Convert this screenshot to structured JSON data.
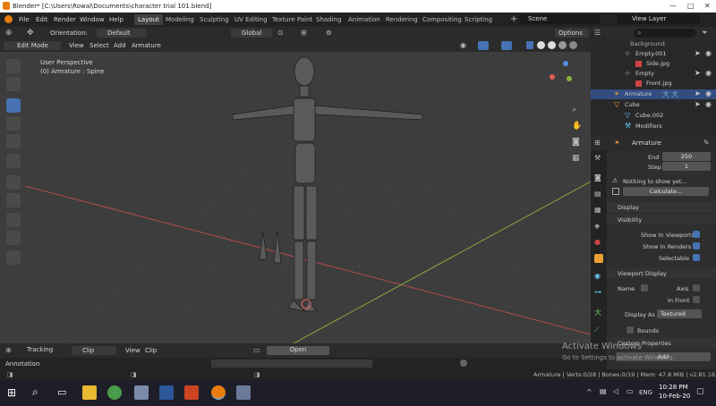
{
  "window": {
    "title": "Blender* [C:\\Users\\Rowal\\Documents\\character trial 101.blend]"
  },
  "menu": [
    "File",
    "Edit",
    "Render",
    "Window",
    "Help"
  ],
  "workspaces": [
    "Layout",
    "Modeling",
    "Sculpting",
    "UV Editing",
    "Texture Paint",
    "Shading",
    "Animation",
    "Rendering",
    "Compositing",
    "Scripting"
  ],
  "scene": {
    "name": "Scene",
    "view_layer": "View Layer"
  },
  "header": {
    "orientation_label": "Orientation:",
    "orientation_value": "Default",
    "transform": "Global",
    "options": "Options",
    "mode": "Edit Mode",
    "view": "View",
    "select": "Select",
    "add": "Add",
    "armature": "Armature"
  },
  "viewport": {
    "perspective": "User Perspective",
    "object": "(0) Armature : Spine",
    "axis_x": "X",
    "axis_y": "Y",
    "axis_z": "Z"
  },
  "timeline": {
    "tracking": "Tracking",
    "clip": "Clip",
    "view": "View",
    "clip2": "Clip",
    "open": "Open",
    "annotation": "Annotation"
  },
  "outliner": {
    "items": [
      {
        "label": "Background"
      },
      {
        "label": "Empty.001"
      },
      {
        "label": "Side.jpg"
      },
      {
        "label": "Empty"
      },
      {
        "label": "Front.jpg"
      },
      {
        "label": "Armature"
      },
      {
        "label": "Cube"
      },
      {
        "label": "Cube.002"
      },
      {
        "label": "Modifiers"
      }
    ]
  },
  "properties": {
    "object_name": "Armature",
    "end_label": "End",
    "end_value": "250",
    "step_label": "Step",
    "step_value": "1",
    "nothing": "Nothing to show yet...",
    "calculate": "Calculate...",
    "display": "Display",
    "visibility": "Visibility",
    "show_viewports": "Show In Viewports",
    "show_renders": "Show In Renders",
    "selectable": "Selectable",
    "viewport_display": "Viewport Display",
    "name": "Name",
    "axis": "Axis",
    "in_front": "In Front",
    "display_as_label": "Display As",
    "display_as_value": "Textured",
    "bounds": "Bounds",
    "custom_properties": "Custom Properties",
    "add": "Add"
  },
  "status": {
    "text": "Armature | Verts:0/28 | Bones:0/19 | Mem: 47.8 MiB | v2.81.16"
  },
  "activate": {
    "line1": "Activate Windows",
    "line2": "Go to Settings to activate Windows."
  },
  "taskbar": {
    "time": "10:28 PM",
    "date": "10-Feb-20",
    "lang": "ENG"
  },
  "colors": {
    "accent": "#4772b3",
    "viewport": "#3d3d3d",
    "selection": "#334d80",
    "x_axis": "#c24c4c",
    "y_axis": "#8bb33a"
  }
}
